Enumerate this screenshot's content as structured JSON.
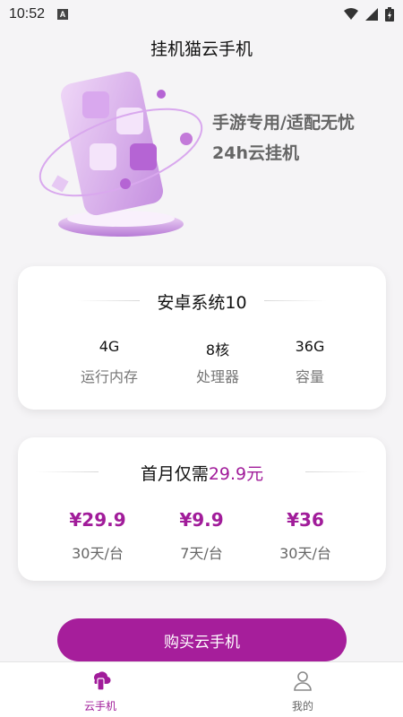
{
  "status_bar": {
    "time": "10:52",
    "badge": "A"
  },
  "header": {
    "title": "挂机猫云手机"
  },
  "hero": {
    "line1": "手游专用/适配无忧",
    "line2": "24h云挂机"
  },
  "os_card": {
    "title": "安卓系统10",
    "specs": [
      {
        "value": "4G",
        "label": "运行内存"
      },
      {
        "value": "8核",
        "label": "处理器"
      },
      {
        "value": "36G",
        "label": "容量"
      }
    ]
  },
  "price_card": {
    "title_prefix": "首月仅需",
    "title_price": "29.9元",
    "plans": [
      {
        "amount": "¥29.9",
        "period": "30天/台"
      },
      {
        "amount": "¥9.9",
        "period": "7天/台"
      },
      {
        "amount": "¥36",
        "period": "30天/台"
      }
    ]
  },
  "buy_button": {
    "label": "购买云手机"
  },
  "tabbar": {
    "tabs": [
      {
        "label": "云手机",
        "icon": "cloud-phone-icon",
        "active": true
      },
      {
        "label": "我的",
        "icon": "user-icon",
        "active": false
      }
    ]
  },
  "colors": {
    "accent": "#a11c9a",
    "button": "#a61e9b",
    "background": "#f5f4f6"
  }
}
